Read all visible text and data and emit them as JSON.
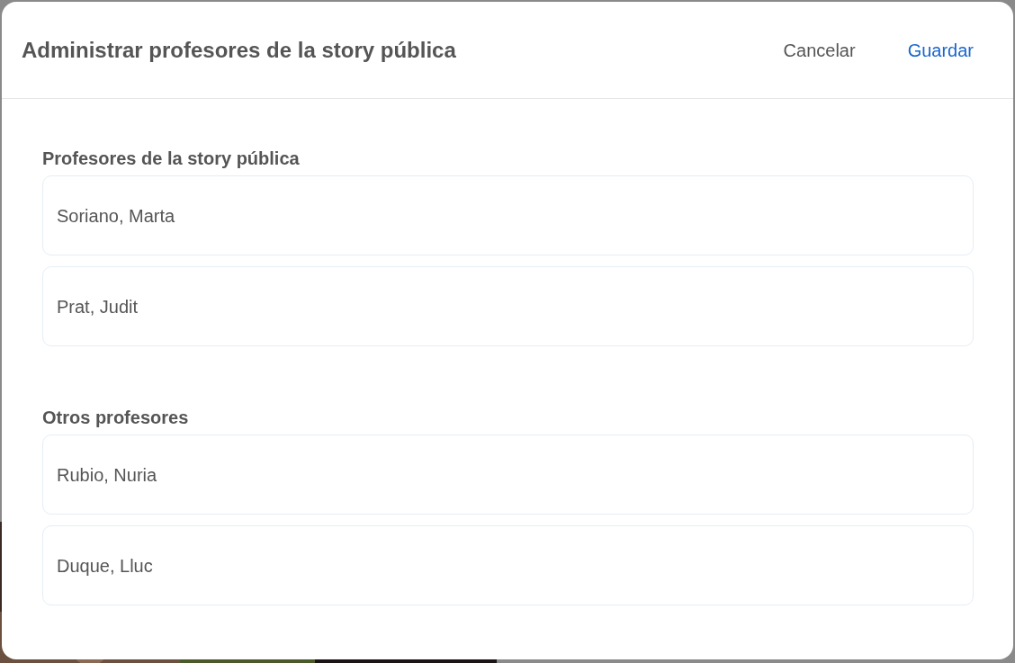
{
  "dialog": {
    "title": "Administrar profesores de la story pública",
    "cancel": "Cancelar",
    "save": "Guardar"
  },
  "sections": [
    {
      "heading": "Profesores de la story pública",
      "teachers": [
        "Soriano, Marta",
        "Prat, Judit"
      ]
    },
    {
      "heading": "Otros profesores",
      "teachers": [
        "Rubio, Nuria",
        "Duque, Lluc"
      ]
    }
  ]
}
